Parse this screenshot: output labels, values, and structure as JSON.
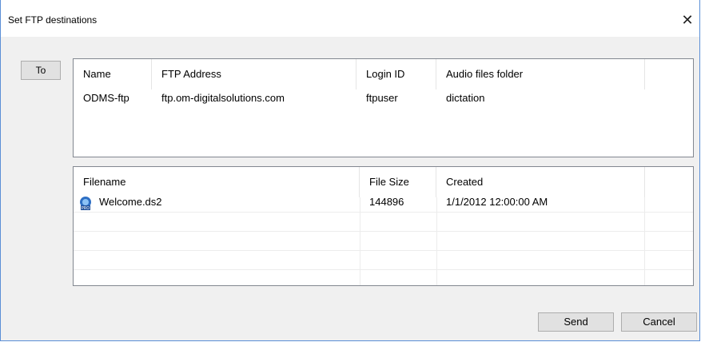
{
  "window": {
    "title": "Set FTP destinations",
    "close_glyph": "✕"
  },
  "buttons": {
    "to_label": "To",
    "send_label": "Send",
    "cancel_label": "Cancel"
  },
  "destinations": {
    "columns": [
      "Name",
      "FTP Address",
      "Login ID",
      "Audio files folder"
    ],
    "rows": [
      {
        "name": "ODMS-ftp",
        "address": "ftp.om-digitalsolutions.com",
        "login": "ftpuser",
        "folder": "dictation"
      }
    ]
  },
  "files": {
    "columns": [
      "Filename",
      "File Size",
      "Created"
    ],
    "rows": [
      {
        "filename": "Welcome.ds2",
        "size": "144896",
        "created": "1/1/2012 12:00:00 AM",
        "icon": "ds2-audio-file-icon"
      }
    ]
  },
  "colors": {
    "accent": "#5b8fd6",
    "selection_border": "#adadad"
  }
}
